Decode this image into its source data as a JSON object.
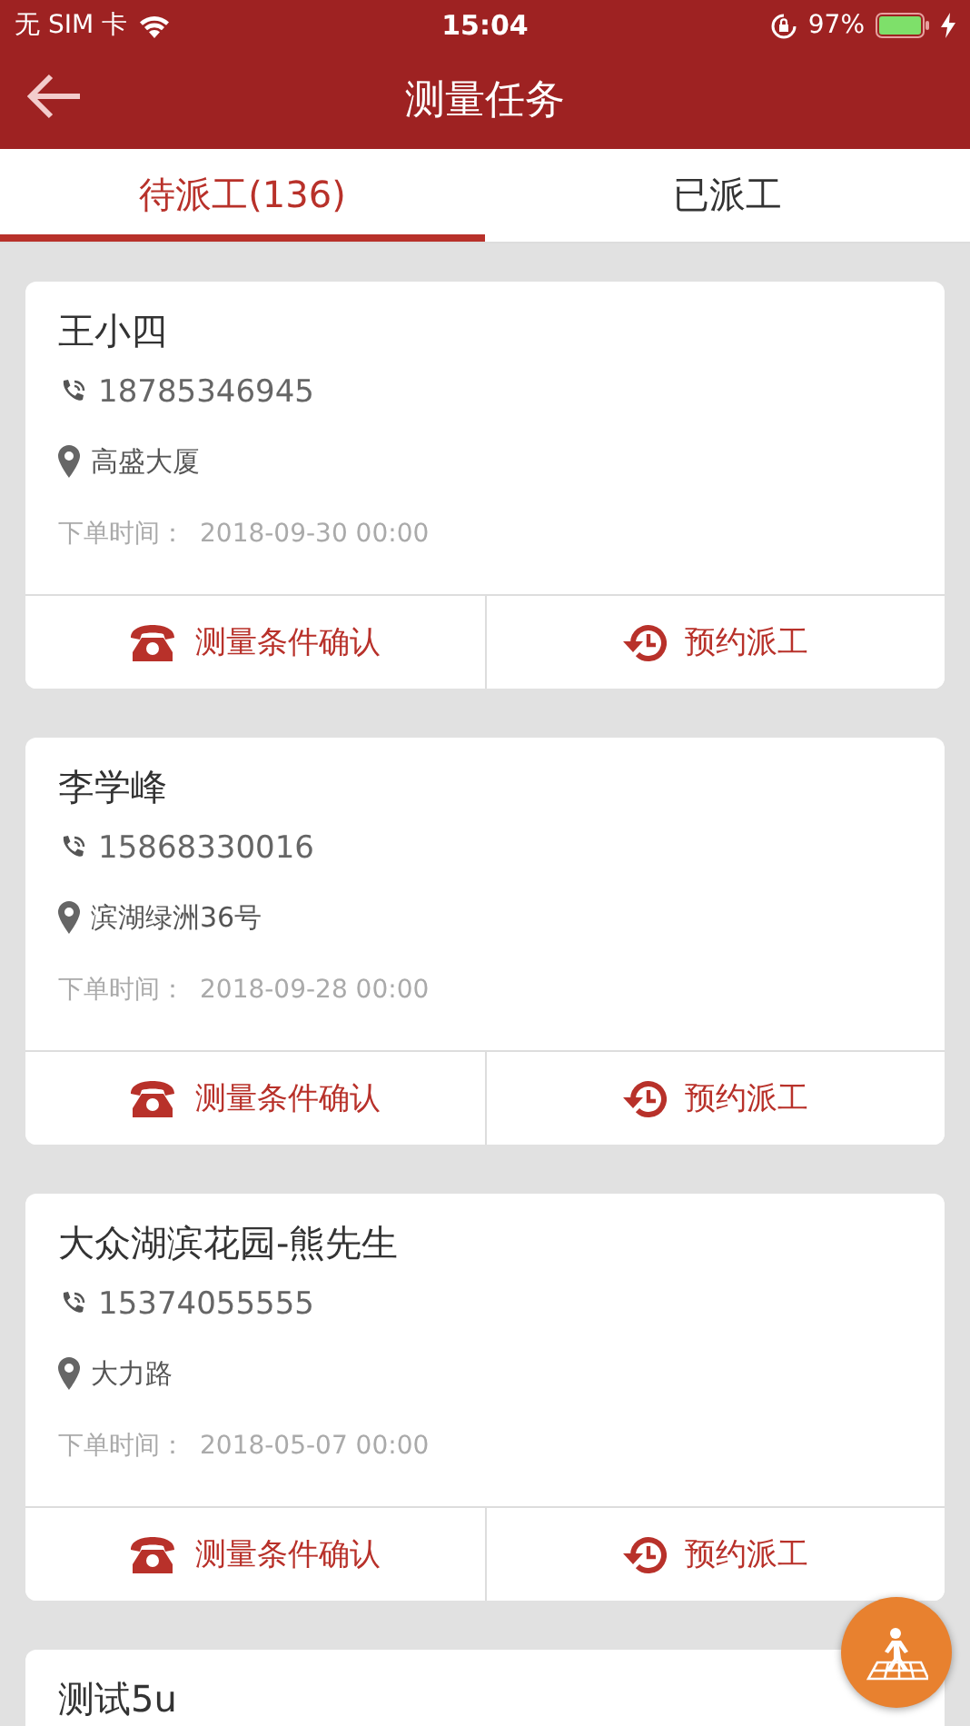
{
  "status_bar": {
    "carrier": "无 SIM 卡",
    "time": "15:04",
    "battery": "97%"
  },
  "header": {
    "title": "测量任务"
  },
  "tabs": [
    {
      "label": "待派工(136)",
      "selected": true
    },
    {
      "label": "已派工",
      "selected": false
    }
  ],
  "orders": [
    {
      "name": "王小四",
      "phone": "18785346945",
      "address": "高盛大厦",
      "time_label": "下单时间：",
      "time": "2018-09-30 00:00",
      "actions": [
        {
          "kind": "phone",
          "label": "测量条件确认"
        },
        {
          "kind": "schedule",
          "label": "预约派工"
        }
      ]
    },
    {
      "name": "李学峰",
      "phone": "15868330016",
      "address": "滨湖绿洲36号",
      "time_label": "下单时间：",
      "time": "2018-09-28 00:00",
      "actions": [
        {
          "kind": "phone",
          "label": "测量条件确认"
        },
        {
          "kind": "schedule",
          "label": "预约派工"
        }
      ]
    },
    {
      "name": "大众湖滨花园-熊先生",
      "phone": "15374055555",
      "address": "大力路",
      "time_label": "下单时间：",
      "time": "2018-05-07 00:00",
      "actions": [
        {
          "kind": "phone",
          "label": "测量条件确认"
        },
        {
          "kind": "schedule",
          "label": "预约派工"
        }
      ]
    },
    {
      "name": "测试5u"
    }
  ]
}
